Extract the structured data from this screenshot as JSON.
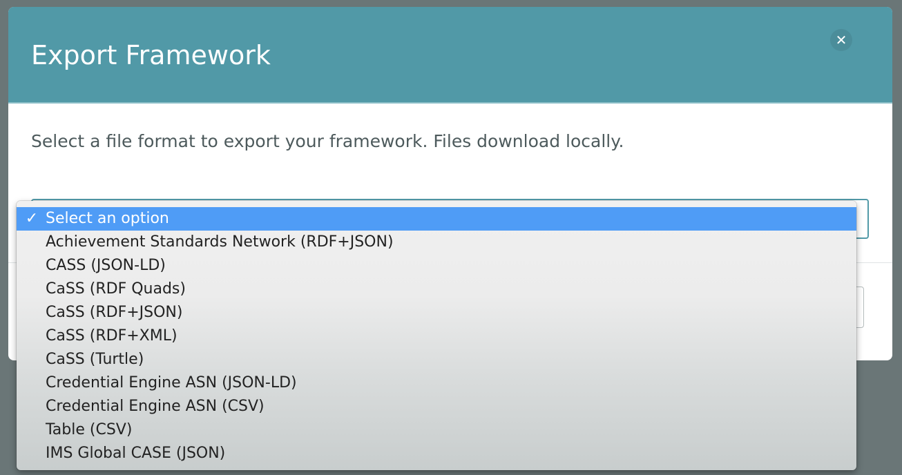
{
  "modal": {
    "title": "Export Framework",
    "close_icon": "close-icon",
    "description": "Select a file format to export your framework. Files download locally."
  },
  "select": {
    "selected_value": "Select an option",
    "options": [
      "Select an option",
      "Achievement Standards Network (RDF+JSON)",
      "CASS (JSON-LD)",
      "CaSS (RDF Quads)",
      "CaSS (RDF+JSON)",
      "CaSS (RDF+XML)",
      "CaSS (Turtle)",
      "Credential Engine ASN (JSON-LD)",
      "Credential Engine ASN (CSV)",
      "Table (CSV)",
      "IMS Global CASE (JSON)"
    ]
  },
  "colors": {
    "header": "#5199a7",
    "highlight": "#4f9cf6",
    "backdrop": "#6a7677"
  }
}
